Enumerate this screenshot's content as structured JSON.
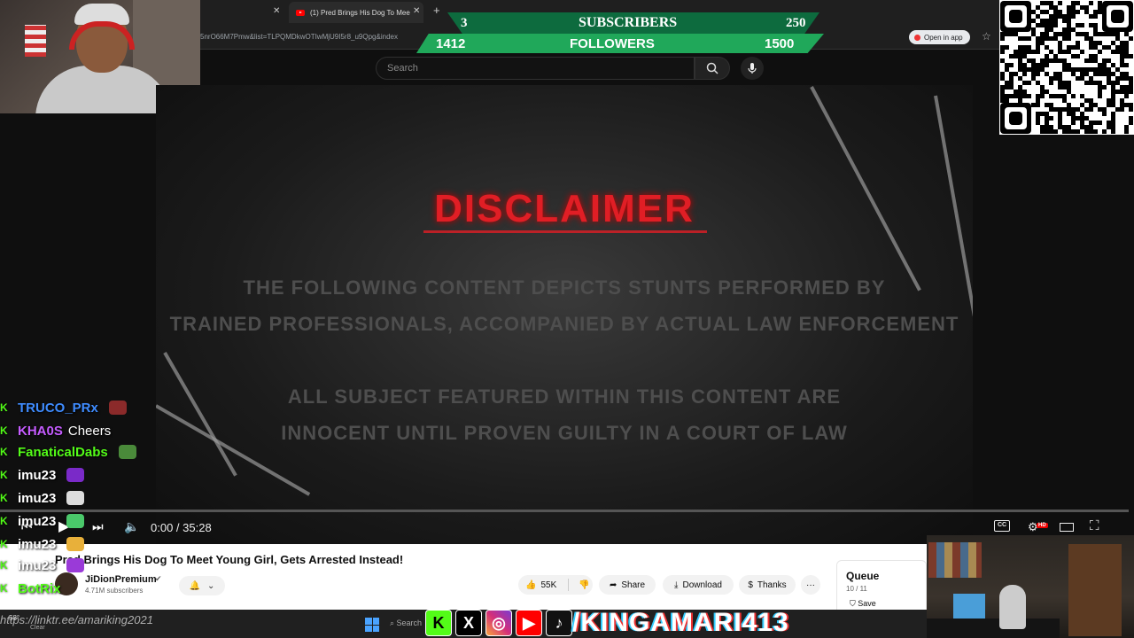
{
  "browser": {
    "tab_active_title": "(1) Pred Brings His Dog To Mee",
    "tab_add": "+",
    "url": "5nrO66M7Pmw&list=TLPQMDkwOTIwMjU9I5r8_u9Qpg&index",
    "open_in_app": "Open in app"
  },
  "goals": {
    "subscribers": {
      "current": "3",
      "label": "SUBSCRIBERS",
      "target": "250"
    },
    "followers": {
      "current": "1412",
      "label": "FOLLOWERS",
      "target": "1500"
    }
  },
  "youtube": {
    "search_placeholder": "Search"
  },
  "video": {
    "heading": "DISCLAIMER",
    "lines": [
      "THE FOLLOWING CONTENT DEPICTS STUNTS PERFORMED BY",
      "TRAINED PROFESSIONALS, ACCOMPANIED BY ACTUAL LAW ENFORCEMENT",
      "",
      "ALL SUBJECT FEATURED WITHIN THIS CONTENT ARE",
      "INNOCENT UNTIL PROVEN GUILTY IN A COURT OF LAW"
    ],
    "time": "0:00 / 35:28",
    "cc_label": "CC",
    "hd_badge": "HD",
    "progress_fraction": 0.0
  },
  "info": {
    "title": "Pred Brings His Dog To Meet Young Girl, Gets Arrested Instead!",
    "channel": "JiDionPremium",
    "subscribers": "4.71M subscribers",
    "likes": "55K",
    "share": "Share",
    "download": "Download",
    "thanks": "Thanks",
    "more": "···"
  },
  "queue": {
    "title": "Queue",
    "count": "10 / 11",
    "save": "Save"
  },
  "chat": [
    {
      "user": "TRUCO_PRx",
      "text": "",
      "color": "#3f8cff",
      "emote": "#8b2a2a"
    },
    {
      "user": "KHA0S",
      "text": "Cheers",
      "color": "#c55cff",
      "emote": ""
    },
    {
      "user": "FanaticalDabs",
      "text": "",
      "color": "#53fc18",
      "emote": "#4a8a3a"
    },
    {
      "user": "imu23",
      "text": "",
      "color": "#ffffff",
      "emote": "#7a2ac8"
    },
    {
      "user": "imu23",
      "text": "",
      "color": "#ffffff",
      "emote": "#dddddd"
    },
    {
      "user": "imu23",
      "text": "",
      "color": "#ffffff",
      "emote": "#4ac86a"
    },
    {
      "user": "imu23",
      "text": "",
      "color": "#ffffff",
      "emote": "#e8b03a"
    },
    {
      "user": "imu23",
      "text": "",
      "color": "#ffffff",
      "emote": "#9a3ad8"
    },
    {
      "user": "BotRix",
      "text": "",
      "color": "#53fc18",
      "emote": ""
    }
  ],
  "stream": {
    "handle": "/KINGAMARI413",
    "link": "https://linktr.ee/amariking2021",
    "weather_temp": "58°",
    "weather_text": "Clear",
    "taskbar_search": "Search",
    "cashapp_symbol": "$"
  },
  "colors": {
    "subscriber_bar": "#0d6b3e",
    "follower_bar": "#20a85a",
    "disclaimer_red": "#e01e25",
    "kick_green": "#53fc18",
    "cashapp_green": "#00d632"
  }
}
